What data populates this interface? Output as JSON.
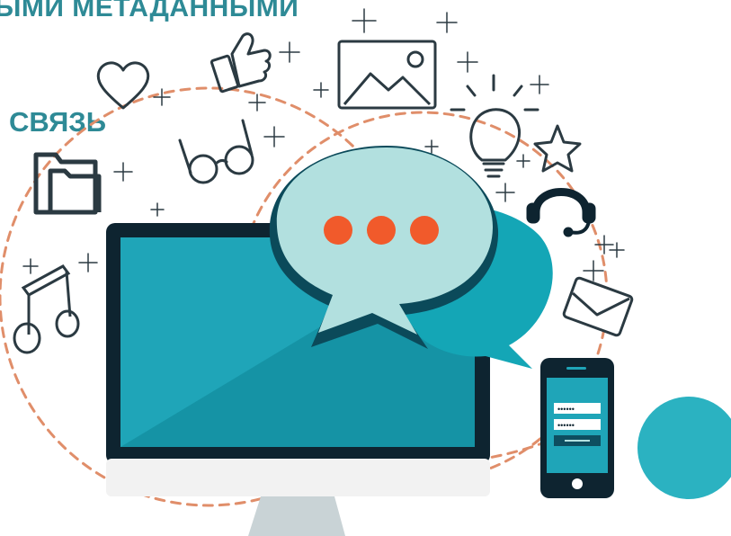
{
  "headline": "ЫМИ МЕТАДАННЫМИ",
  "subheadline": "СВЯЗЬ",
  "colors": {
    "title": "#2E8A96",
    "outline": "#2B3A42",
    "screen": "#1FA5B8",
    "screen_dark": "#0C8596",
    "bezel": "#0E2430",
    "bubble_front": "#B2E0DF",
    "bubble_back": "#14A6B6",
    "dots": "#F15A2B",
    "dashes": "#E08E6A",
    "accent_circle": "#2BB2C1"
  },
  "icons": [
    "heart-icon",
    "thumbs-up-icon",
    "image-icon",
    "lightbulb-icon",
    "star-icon",
    "folder-icon",
    "glasses-icon",
    "headset-icon",
    "music-note-icon",
    "envelope-icon"
  ],
  "phone": {
    "password_mask": "••••••",
    "password_mask_2": "••••••"
  }
}
